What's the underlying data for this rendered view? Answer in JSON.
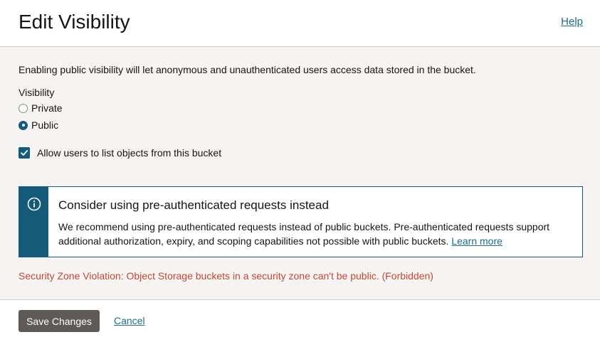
{
  "header": {
    "title": "Edit Visibility",
    "help_label": "Help"
  },
  "form": {
    "intro": "Enabling public visibility will let anonymous and unauthenticated users access data stored in the bucket.",
    "visibility_label": "Visibility",
    "options": [
      {
        "label": "Private",
        "selected": false
      },
      {
        "label": "Public",
        "selected": true
      }
    ],
    "allow_list_label": "Allow users to list objects from this bucket",
    "allow_list_checked": true
  },
  "notice": {
    "icon": "info-icon",
    "title": "Consider using pre-authenticated requests instead",
    "text": "We recommend using pre-authenticated requests instead of public buckets. Pre-authenticated requests support additional authorization, expiry, and scoping capabilities not possible with public buckets.",
    "link_label": "Learn more"
  },
  "error": {
    "message": "Security Zone Violation: Object Storage buckets in a security zone can't be public. (Forbidden)",
    "color": "#c74634"
  },
  "footer": {
    "save_label": "Save Changes",
    "cancel_label": "Cancel"
  },
  "colors": {
    "accent": "#155a78",
    "link": "#1e6b8a",
    "primary_button": "#5f5a55"
  }
}
